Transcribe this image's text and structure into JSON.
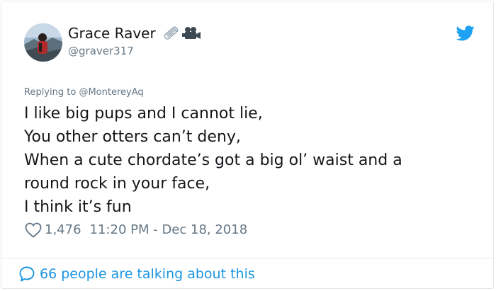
{
  "user": {
    "display_name": "Grace Raver",
    "handle": "@graver317",
    "emoji_icons": [
      "newspaper-roll-icon",
      "video-camera-icon"
    ]
  },
  "reply": {
    "prefix": "Replying to ",
    "mention": "@MontereyAq"
  },
  "tweet": {
    "lines": [
      "I like big pups and I cannot lie,",
      "You other otters can’t deny,",
      "When a cute chordate’s got a big ol’ waist and a",
      "round rock in your face,",
      "I think it’s fun"
    ]
  },
  "meta": {
    "likes": "1,476",
    "timestamp": "11:20 PM - Dec 18, 2018"
  },
  "footer": {
    "talking_text": "66 people are talking about this"
  },
  "colors": {
    "twitter_blue": "#1da1f2",
    "link_blue": "#1b95e0",
    "secondary_text": "#657786",
    "border": "#e1e8ed"
  }
}
